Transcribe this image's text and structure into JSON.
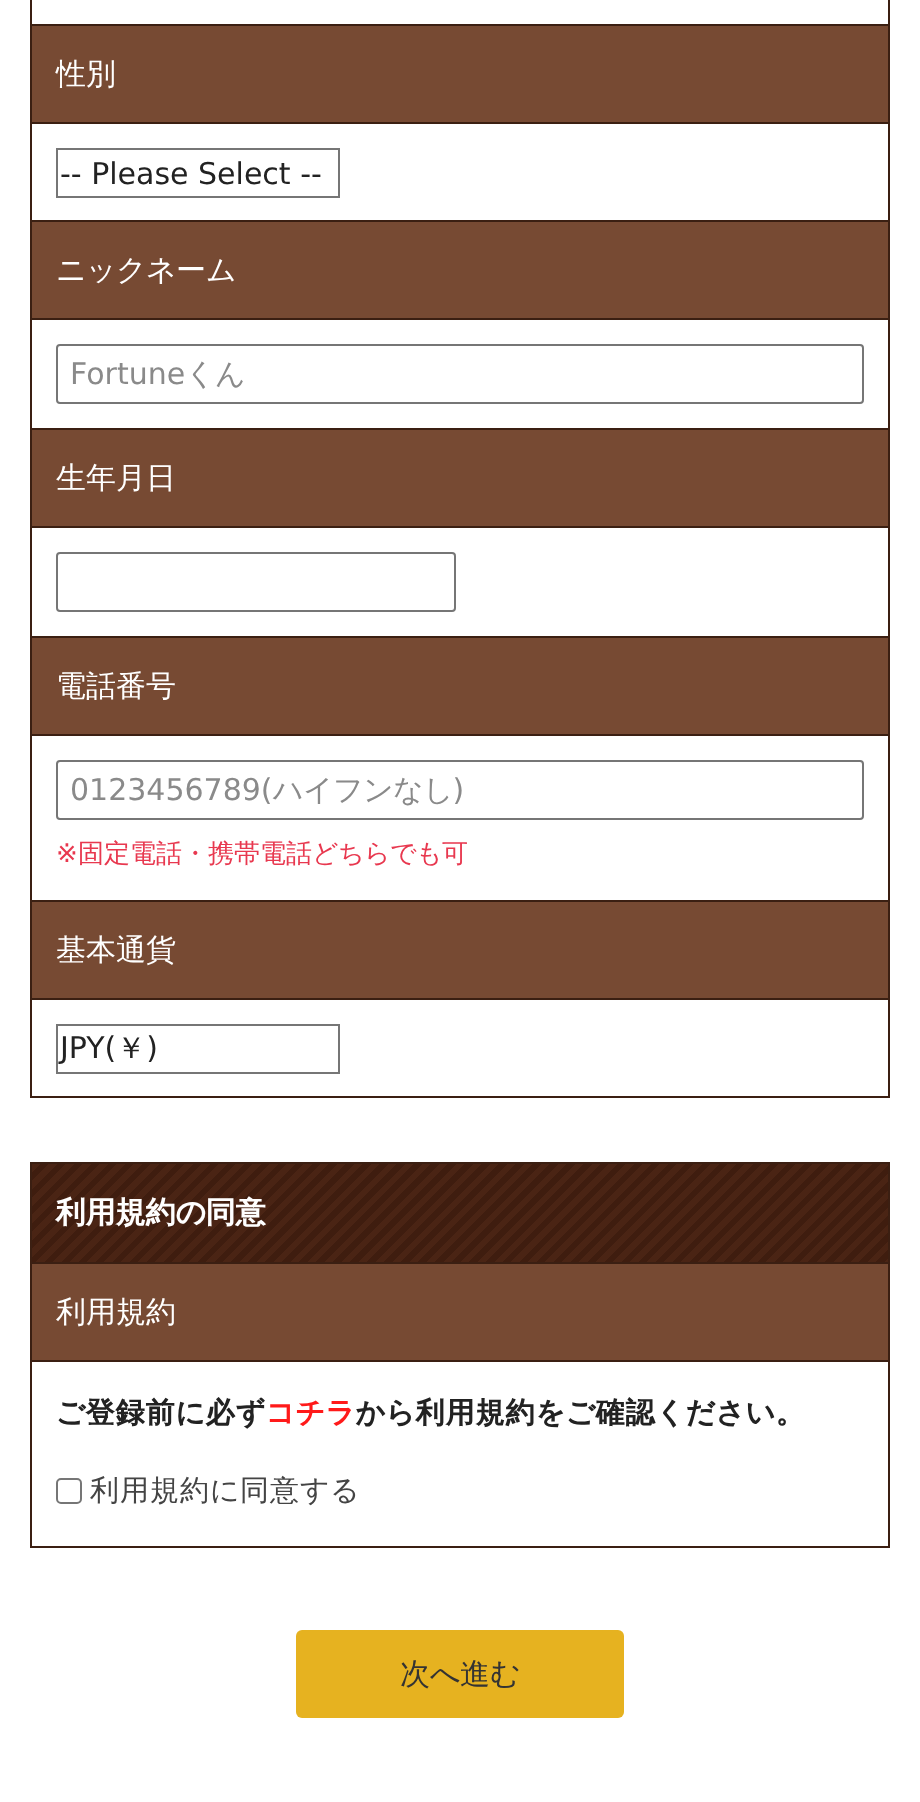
{
  "fields": [
    {
      "label": "性別",
      "kind": "select",
      "value": "-- Please Select --"
    },
    {
      "label": "ニックネーム",
      "kind": "text",
      "placeholder": "Fortuneくん"
    },
    {
      "label": "生年月日",
      "kind": "date"
    },
    {
      "label": "電話番号",
      "kind": "text",
      "placeholder": "0123456789(ハイフンなし)",
      "note": "※固定電話・携帯電話どちらでも可"
    },
    {
      "label": "基本通貨",
      "kind": "select",
      "value": "JPY(￥)"
    }
  ],
  "agreement": {
    "title": "利用規約の同意",
    "label": "利用規約",
    "notice_before": "ご登録前に必ず",
    "link": "コチラ",
    "notice_after": "から利用規約をご確認ください。",
    "checkbox": {
      "label": "利用規約に同意する",
      "checked": false
    }
  },
  "next_button": "次へ進む"
}
